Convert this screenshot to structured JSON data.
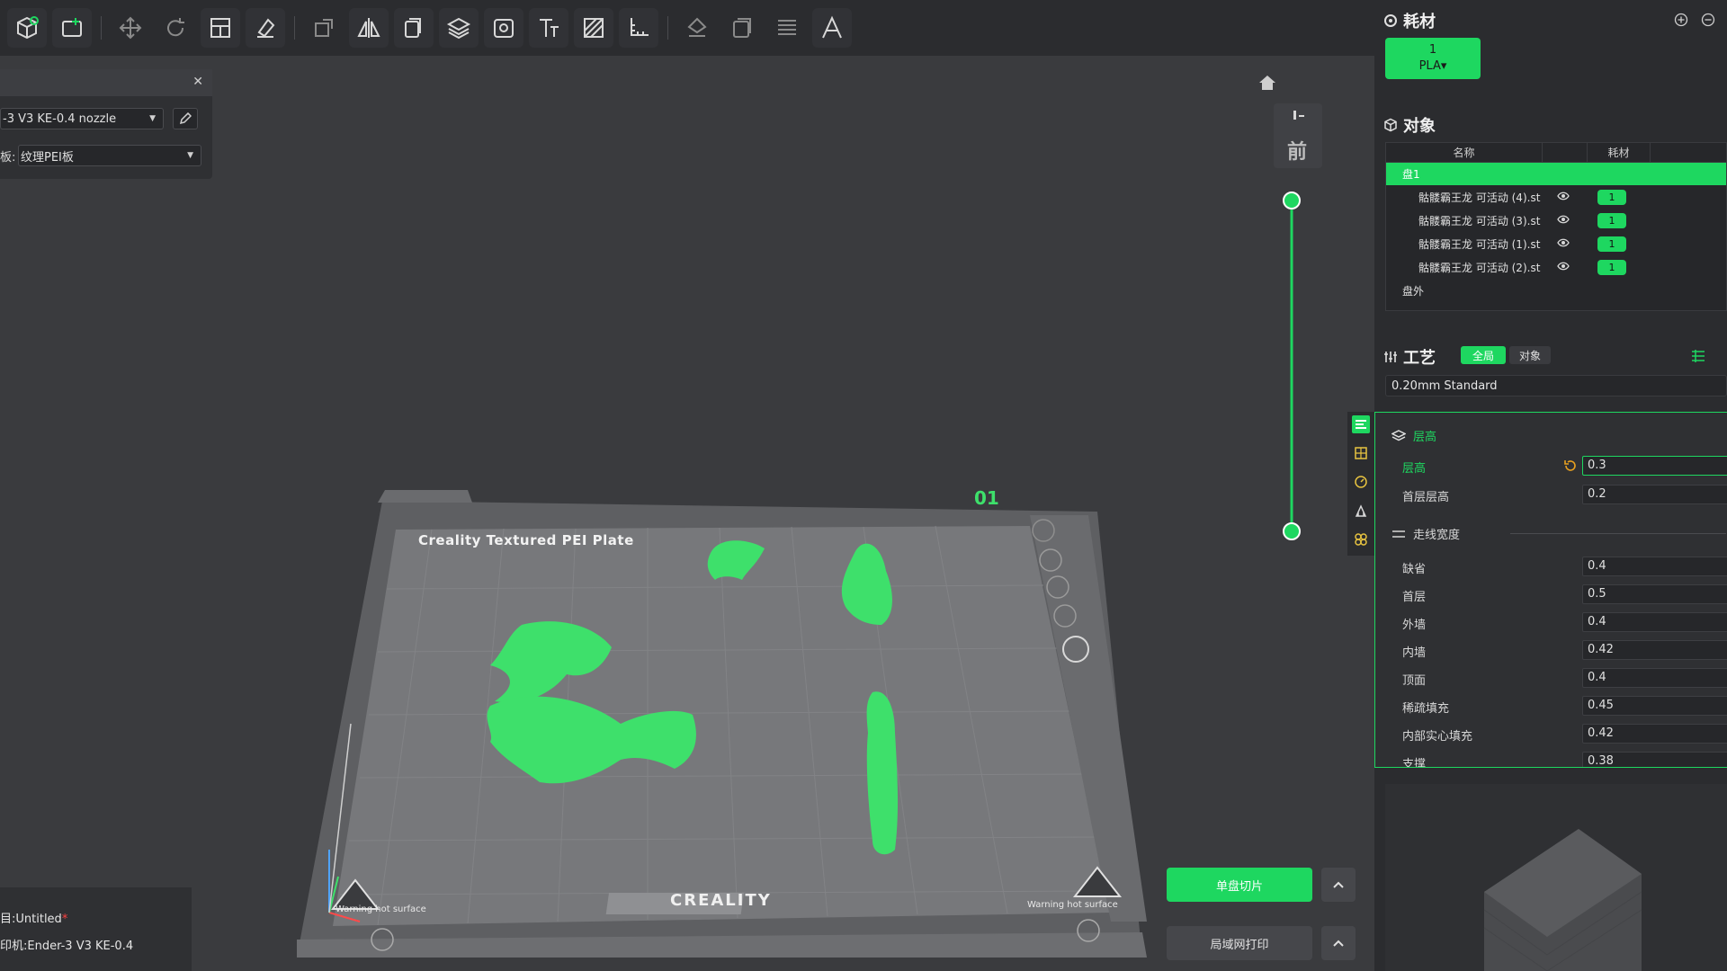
{
  "printer_panel": {
    "printer_value": "-3 V3 KE-0.4 nozzle",
    "plate_label": "板:",
    "plate_value": "纹理PEI板"
  },
  "bed": {
    "plate_name": "Creality Textured PEI Plate",
    "plate_number": "01",
    "brand": "CREALITY",
    "warning_left": "Warning hot surface",
    "warning_right": "Warning hot surface"
  },
  "view": {
    "front_label": "前"
  },
  "actions": {
    "slice_label": "单盘切片",
    "print_label": "局域网打印"
  },
  "status": {
    "project": "目:Untitled",
    "modified_mark": "*",
    "printer": "印机:Ender-3 V3 KE-0.4"
  },
  "filament": {
    "title": "耗材",
    "slot_number": "1",
    "slot_type": "PLA▾"
  },
  "objects": {
    "title": "对象",
    "col_name": "名称",
    "col_filament": "耗材",
    "plate": "盘1",
    "items": [
      {
        "name": "骷髅霸王龙 可活动 (4).st",
        "filament": "1"
      },
      {
        "name": "骷髅霸王龙 可活动 (3).st",
        "filament": "1"
      },
      {
        "name": "骷髅霸王龙 可活动 (1).st",
        "filament": "1"
      },
      {
        "name": "骷髅霸王龙 可活动 (2).st",
        "filament": "1"
      }
    ],
    "outside": "盘外"
  },
  "process": {
    "title": "工艺",
    "tab_global": "全局",
    "tab_object": "对象",
    "preset": "0.20mm Standard",
    "group_layer": "层高",
    "layer_height_label": "层高",
    "layer_height_value": "0.3",
    "first_layer_label": "首层层高",
    "first_layer_value": "0.2",
    "group_width": "走线宽度",
    "widths": [
      {
        "label": "缺省",
        "value": "0.4"
      },
      {
        "label": "首层",
        "value": "0.5"
      },
      {
        "label": "外墙",
        "value": "0.4"
      },
      {
        "label": "内墙",
        "value": "0.42"
      },
      {
        "label": "顶面",
        "value": "0.4"
      },
      {
        "label": "稀疏填充",
        "value": "0.45"
      },
      {
        "label": "内部实心填充",
        "value": "0.42"
      },
      {
        "label": "支撑",
        "value": "0.38"
      }
    ]
  },
  "colors": {
    "accent": "#1ed760",
    "background": "#3a3b3e",
    "panel": "#2b2c2f",
    "model": "#3ee06b"
  }
}
